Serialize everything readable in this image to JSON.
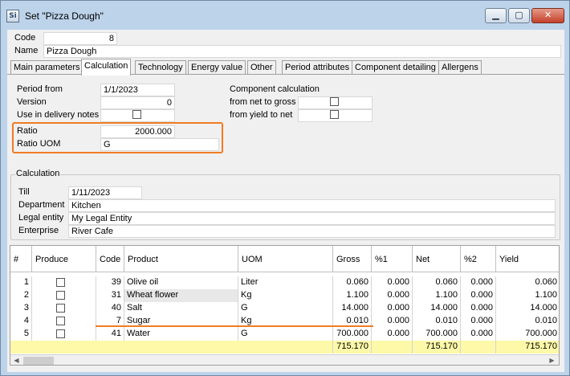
{
  "window": {
    "title": "Set \"Pizza Dough\"",
    "icon_text": "Si",
    "min_label": "▁",
    "max_label": "▢",
    "close_label": "✕"
  },
  "header": {
    "code_label": "Code",
    "code_value": "8",
    "name_label": "Name",
    "name_value": "Pizza Dough"
  },
  "tabs": [
    {
      "label": "Main parameters"
    },
    {
      "label": "Calculation"
    },
    {
      "label": "Technology"
    },
    {
      "label": "Energy value"
    },
    {
      "label": "Other"
    },
    {
      "label": "Period attributes"
    },
    {
      "label": "Component detailing"
    },
    {
      "label": "Allergens"
    }
  ],
  "calc": {
    "period_from_label": "Period from",
    "period_from_value": "1/1/2023",
    "version_label": "Version",
    "version_value": "0",
    "delivery_label": "Use in delivery notes",
    "component_calc_label": "Component calculation",
    "net_to_gross_label": "from net to gross",
    "yield_to_net_label": "from yield to net",
    "ratio_label": "Ratio",
    "ratio_value": "2000.000",
    "ratio_uom_label": "Ratio UOM",
    "ratio_uom_value": "G"
  },
  "calculation_group": {
    "caption": "Calculation",
    "till_label": "Till",
    "till_value": "1/11/2023",
    "department_label": "Department",
    "department_value": "Kitchen",
    "legal_label": "Legal entity",
    "legal_value": "My Legal Entity",
    "enterprise_label": "Enterprise",
    "enterprise_value": "River Cafe"
  },
  "grid": {
    "columns": [
      "#",
      "Produce",
      "Code",
      "Product",
      "UOM",
      "Gross",
      "%1",
      "Net",
      "%2",
      "Yield"
    ],
    "rows": [
      {
        "num": "1",
        "code": "39",
        "product": "Olive oil",
        "uom": "Liter",
        "gross": "0.060",
        "p1": "0.000",
        "net": "0.060",
        "p2": "0.000",
        "yield": "0.060"
      },
      {
        "num": "2",
        "code": "31",
        "product": "Wheat flower",
        "uom": "Kg",
        "gross": "1.100",
        "p1": "0.000",
        "net": "1.100",
        "p2": "0.000",
        "yield": "1.100"
      },
      {
        "num": "3",
        "code": "40",
        "product": "Salt",
        "uom": "G",
        "gross": "14.000",
        "p1": "0.000",
        "net": "14.000",
        "p2": "0.000",
        "yield": "14.000"
      },
      {
        "num": "4",
        "code": "7",
        "product": "Sugar",
        "uom": "Kg",
        "gross": "0.010",
        "p1": "0.000",
        "net": "0.010",
        "p2": "0.000",
        "yield": "0.010"
      },
      {
        "num": "5",
        "code": "41",
        "product": "Water",
        "uom": "G",
        "gross": "700.000",
        "p1": "0.000",
        "net": "700.000",
        "p2": "0.000",
        "yield": "700.000"
      }
    ],
    "totals": {
      "gross": "715.170",
      "net": "715.170",
      "yield": "715.170"
    },
    "scroll_left": "◀",
    "scroll_right": "▶"
  },
  "colors": {
    "highlight": "#f07c22",
    "totals_row": "#fdf9a8"
  }
}
